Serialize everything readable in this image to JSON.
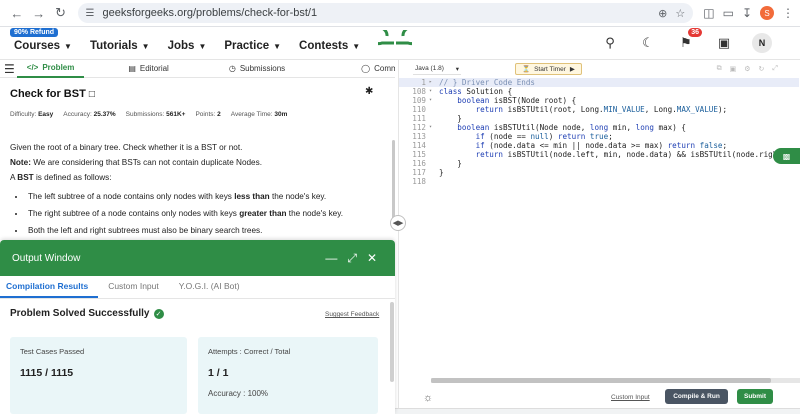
{
  "browser": {
    "url": "geeksforgeeks.org/problems/check-for-bst/1"
  },
  "header": {
    "refund_badge": "90% Refund",
    "nav": [
      "Courses",
      "Tutorials",
      "Jobs",
      "Practice",
      "Contests"
    ],
    "notification_count": "36",
    "avatar_initial": "N",
    "logo_color": "#2f8d46"
  },
  "tabs": {
    "problem": "Problem",
    "editorial": "Editorial",
    "submissions": "Submissions",
    "comments": "Comments"
  },
  "problem": {
    "title": "Check for BST",
    "difficulty_label": "Difficulty:",
    "difficulty": "Easy",
    "accuracy_label": "Accuracy:",
    "accuracy": "25.37%",
    "submissions_label": "Submissions:",
    "submissions": "561K+",
    "points_label": "Points:",
    "points": "2",
    "avg_time_label": "Average Time:",
    "avg_time": "30m",
    "desc1": "Given the root of a binary tree. Check whether it is a BST or not.",
    "note_label": "Note:",
    "note_text": " We are considering that BSTs can not contain duplicate Nodes.",
    "bst_label": "BST",
    "bst_text": " is defined as follows:",
    "bullets": [
      {
        "pre": "The left subtree of a node contains only nodes with keys ",
        "bold": "less than",
        "post": " the node's key."
      },
      {
        "pre": "The right subtree of a node contains only nodes with keys ",
        "bold": "greater than",
        "post": " the node's key."
      },
      {
        "pre": "Both the left and right subtrees must also be binary search trees.",
        "bold": "",
        "post": ""
      }
    ]
  },
  "output": {
    "title": "Output Window",
    "tabs": [
      "Compilation Results",
      "Custom Input",
      "Y.O.G.I. (AI Bot)"
    ],
    "status": "Problem Solved Successfully",
    "feedback": "Suggest Feedback",
    "tests_label": "Test Cases Passed",
    "tests_value": "1115 / 1115",
    "attempts_label": "Attempts : Correct / Total",
    "attempts_value": "1 / 1",
    "accuracy_label": "Accuracy :",
    "accuracy_value": "100%"
  },
  "editor": {
    "language": "Java (1.8)",
    "timer": "Start Timer",
    "lines": [
      {
        "n": "1",
        "fold": "▸",
        "hl": true
      },
      {
        "n": "108",
        "fold": "▾",
        "hl": false
      },
      {
        "n": "109",
        "fold": "▾",
        "hl": false
      },
      {
        "n": "110",
        "fold": "",
        "hl": false
      },
      {
        "n": "111",
        "fold": "",
        "hl": false
      },
      {
        "n": "112",
        "fold": "▾",
        "hl": false
      },
      {
        "n": "113",
        "fold": "",
        "hl": false
      },
      {
        "n": "114",
        "fold": "",
        "hl": false
      },
      {
        "n": "115",
        "fold": "",
        "hl": false
      },
      {
        "n": "116",
        "fold": "",
        "hl": false
      },
      {
        "n": "117",
        "fold": "",
        "hl": false
      },
      {
        "n": "118",
        "fold": "",
        "hl": false
      }
    ],
    "code": {
      "l1_prefix": "// } Driver Code Ends",
      "l108_kw": "class",
      "l108_rest": " Solution {",
      "l109_kw": "boolean",
      "l109_rest": " isBST(Node root) {",
      "l110_kw": "return",
      "l110_a": " isBSTUtil(root, Long.",
      "l110_c1": "MIN_VALUE",
      "l110_b": ", Long.",
      "l110_c2": "MAX_VALUE",
      "l110_end": ");",
      "l111": "}",
      "l112_kw": "boolean",
      "l112_rest": " isBSTUtil(Node node, ",
      "l112_kw2": "long",
      "l112_rest2": " min, ",
      "l112_kw3": "long",
      "l112_rest3": " max) {",
      "l113_kw": "if",
      "l113_a": " (node == ",
      "l113_c": "null",
      "l113_b": ") ",
      "l113_kw2": "return",
      "l113_c2": " true",
      "l113_end": ";",
      "l114_kw": "if",
      "l114_a": " (node.data <= min || node.data >= max) ",
      "l114_kw2": "return",
      "l114_c": " false",
      "l114_end": ";",
      "l115_kw": "return",
      "l115_rest": " isBSTUtil(node.left, min, node.data) && isBSTUtil(node.right,",
      "l116": "}",
      "l117": "}",
      "l118": ""
    },
    "custom_input": "Custom Input",
    "compile": "Compile & Run",
    "submit": "Submit"
  }
}
